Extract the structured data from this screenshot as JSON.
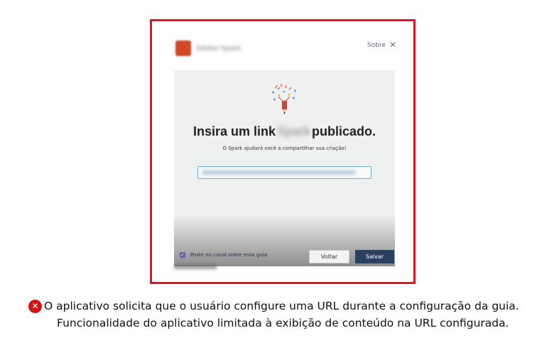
{
  "dialog": {
    "about_label": "Sobre",
    "close_glyph": "✕",
    "headline_start": "Insira um link",
    "headline_end": "publicado.",
    "subtitle": "O Spark ajudará você a compartilhar sua criação!",
    "checkbox_label": "Poste no canal sobre essa guia",
    "checkbox_checked": true,
    "back_label": "Voltar",
    "save_label": "Salvar",
    "colors": {
      "border_error": "#e81123",
      "accent": "#6264a7",
      "primary_button": "#2b3f5f"
    }
  },
  "caption": {
    "icon": "error-x-icon",
    "line1": "O aplicativo solicita que o usuário configure uma URL durante a configuração da guia.",
    "line2": "Funcionalidade do aplicativo limitada à exibição de conteúdo na URL configurada."
  }
}
